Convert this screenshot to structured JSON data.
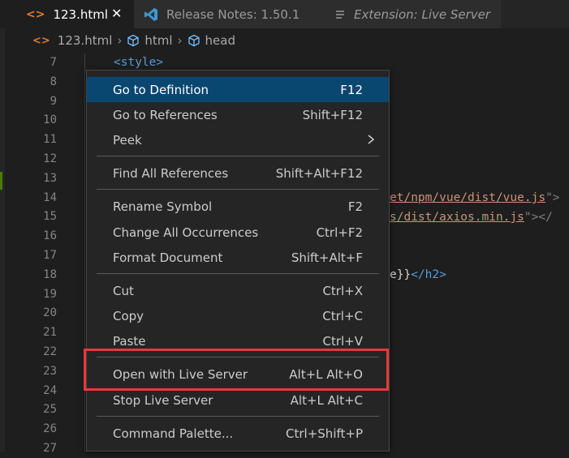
{
  "tabs": [
    {
      "label": "123.html",
      "icon": "html-code-icon",
      "active": true,
      "close": "✕"
    },
    {
      "label": "Release Notes: 1.50.1",
      "icon": "vscode-logo-icon",
      "active": false
    },
    {
      "label": "Extension: Live Server",
      "icon": "preview-list-icon",
      "active": false
    }
  ],
  "breadcrumb": {
    "file": "123.html",
    "items": [
      "html",
      "head"
    ]
  },
  "editor": {
    "line_numbers": [
      "7",
      "8",
      "9",
      "10",
      "11",
      "12",
      "13",
      "14",
      "15",
      "16",
      "17",
      "18",
      "19",
      "20",
      "21",
      "22",
      "23",
      "24",
      "25",
      "26",
      "27"
    ],
    "lines": {
      "l7_tag": "<style>",
      "l14_str": "et/npm/vue/dist/vue.js",
      "l14_end": "\">",
      "l15_str": "s/dist/axios.min.js",
      "l15_end": "\"></",
      "l18_txt": "e}}",
      "l18_end": "</h2>"
    }
  },
  "context_menu": {
    "items": [
      {
        "label": "Go to Definition",
        "shortcut": "F12",
        "selected": true
      },
      {
        "label": "Go to References",
        "shortcut": "Shift+F12"
      },
      {
        "label": "Peek",
        "shortcut": "",
        "submenu": true
      },
      {
        "label": "Find All References",
        "shortcut": "Shift+Alt+F12"
      },
      {
        "label": "Rename Symbol",
        "shortcut": "F2"
      },
      {
        "label": "Change All Occurrences",
        "shortcut": "Ctrl+F2"
      },
      {
        "label": "Format Document",
        "shortcut": "Shift+Alt+F"
      },
      {
        "label": "Cut",
        "shortcut": "Ctrl+X"
      },
      {
        "label": "Copy",
        "shortcut": "Ctrl+C"
      },
      {
        "label": "Paste",
        "shortcut": "Ctrl+V"
      },
      {
        "label": "Open with Live Server",
        "shortcut": "Alt+L Alt+O",
        "highlighted": true
      },
      {
        "label": "Stop Live Server",
        "shortcut": "Alt+L Alt+C"
      },
      {
        "label": "Command Palette...",
        "shortcut": "Ctrl+Shift+P"
      }
    ]
  },
  "colors": {
    "menu_selection": "#094771",
    "highlight_box": "#e8383b",
    "html_icon": "#e37933",
    "vscode_icon": "#3c99d4"
  }
}
